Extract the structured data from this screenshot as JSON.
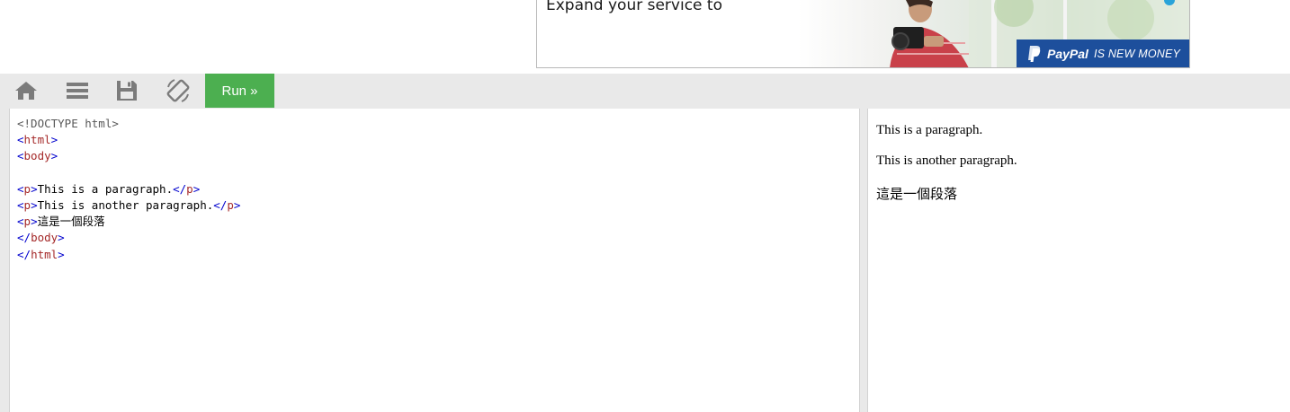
{
  "ad": {
    "headline": "Expand your service to",
    "brand": "PayPal",
    "tagline": "IS NEW MONEY",
    "colors": {
      "brand_blue": "#1d4f9c",
      "info_dot": "#29a3d9"
    }
  },
  "toolbar": {
    "home_icon": "home-icon",
    "menu_icon": "menu-icon",
    "save_icon": "save-icon",
    "rotate_icon": "rotate-icon",
    "run_label": "Run »",
    "colors": {
      "run_bg": "#4caf50",
      "icon": "#7b7b7b",
      "bar_bg": "#e9e9e9"
    }
  },
  "editor": {
    "lines": [
      {
        "open": "<!DOCTYPE html>"
      },
      {
        "tag": "html"
      },
      {
        "tag": "body"
      },
      {
        "blank": ""
      },
      {
        "tag": "p",
        "text": "This is a paragraph.",
        "close": "p"
      },
      {
        "tag": "p",
        "text": "This is another paragraph.",
        "close": "p"
      },
      {
        "tag": "p",
        "text": "這是一個段落"
      },
      {
        "endtag": "body"
      },
      {
        "endtag": "html"
      }
    ],
    "colors": {
      "bracket": "#0000cd",
      "tagname": "#a52a2a"
    }
  },
  "result": {
    "paragraphs": [
      "This is a paragraph.",
      "This is another paragraph.",
      "這是一個段落"
    ]
  }
}
